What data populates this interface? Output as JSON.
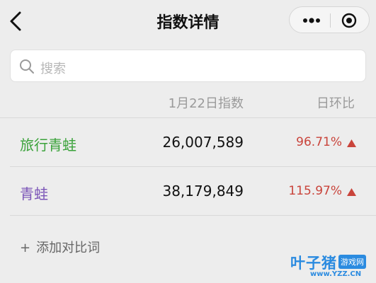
{
  "header": {
    "title": "指数详情",
    "back_icon": "chevron-left-icon",
    "more_icon": "more-dots-icon",
    "close_icon": "target-close-icon"
  },
  "search": {
    "placeholder": "搜索",
    "icon": "search-icon"
  },
  "table": {
    "columns": [
      "1月22日指数",
      "日环比"
    ],
    "rows": [
      {
        "name": "旅行青蛙",
        "value": "26,007,589",
        "ratio": "96.71%",
        "trend": "up",
        "name_color": "#3aa23a"
      },
      {
        "name": "青蛙",
        "value": "38,179,849",
        "ratio": "115.97%",
        "trend": "up",
        "name_color": "#7c56b8"
      }
    ],
    "trend_color": "#c9443b"
  },
  "add_compare": {
    "plus": "+",
    "label": "添加对比词"
  },
  "watermark": {
    "main": "叶子猪",
    "tag": "游戏网",
    "url": "www.YZZ.CN"
  }
}
